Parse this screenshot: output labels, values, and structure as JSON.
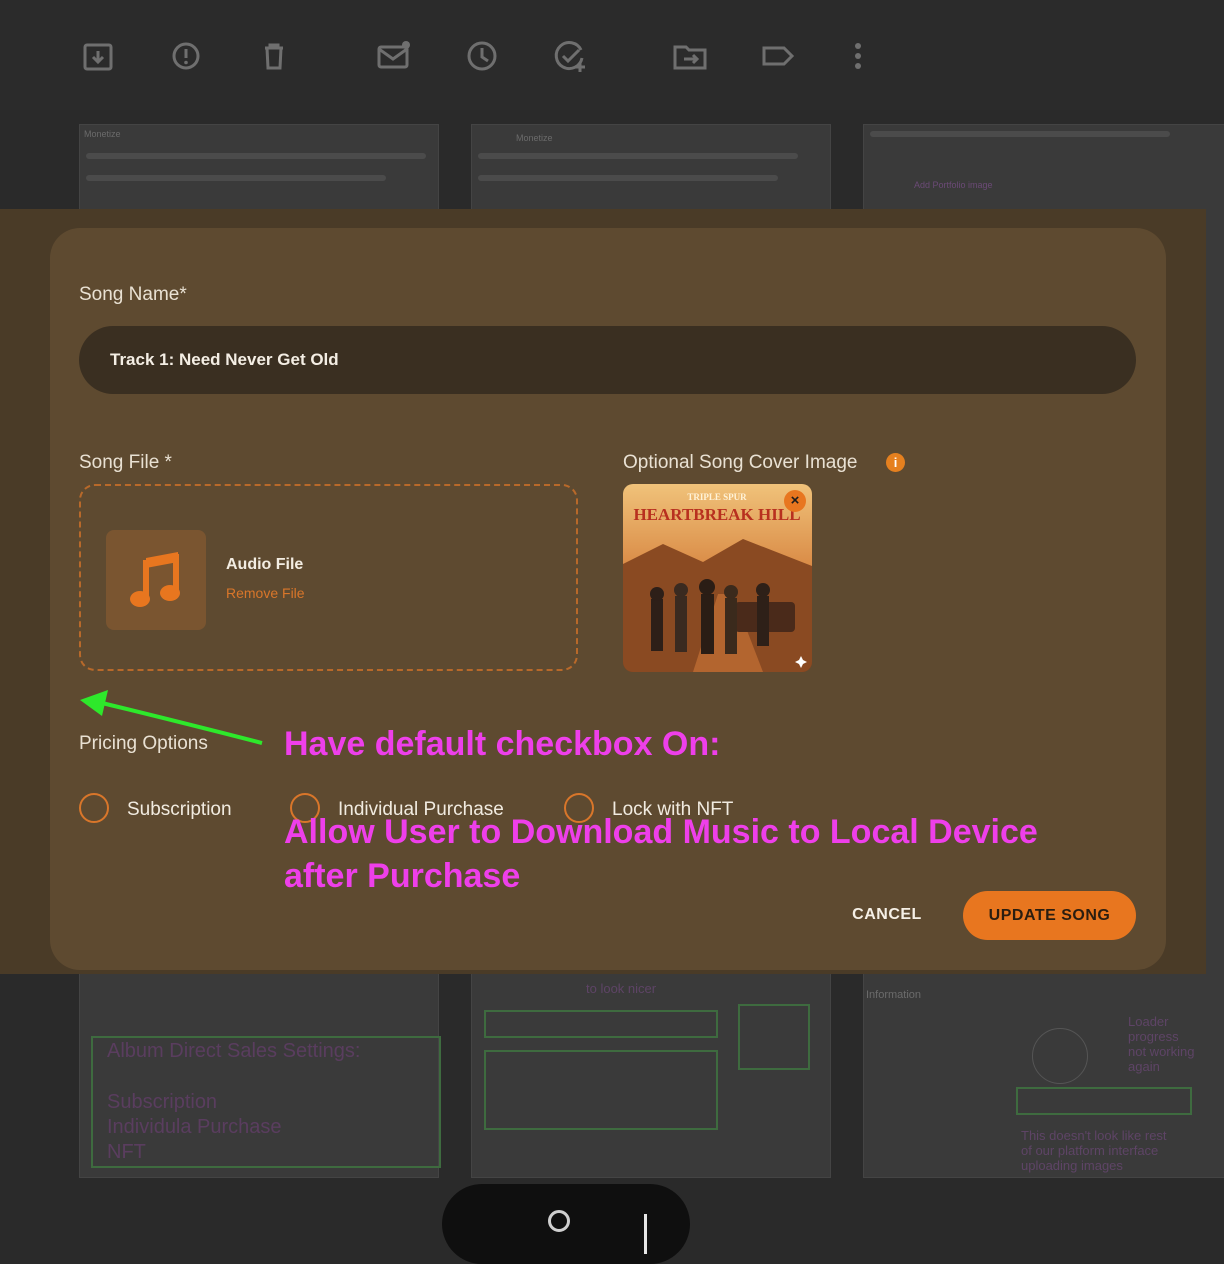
{
  "toolbar": {
    "icons": [
      "archive-icon",
      "report-icon",
      "delete-icon",
      "mark-unread-icon",
      "snooze-icon",
      "add-task-icon",
      "move-to-icon",
      "label-icon",
      "more-icon"
    ]
  },
  "modal": {
    "song_name_label": "Song Name*",
    "song_name_value": "Track 1: Need Never Get Old",
    "song_file_label": "Song File *",
    "cover_label": "Optional Song Cover Image",
    "info_glyph": "i",
    "file": {
      "title": "Audio File",
      "remove": "Remove File"
    },
    "cover_art": {
      "band": "TRIPLE SPUR",
      "title": "HEARTBREAK HILL"
    },
    "cover_close": "×",
    "pricing_label": "Pricing Options",
    "pricing_options": [
      "Subscription",
      "Individual Purchase",
      "Lock with NFT"
    ],
    "cancel_label": "CANCEL",
    "update_label": "UPDATE SONG"
  },
  "annotations": {
    "line1": "Have default checkbox On:",
    "line2": "Allow User to Download Music to Local Device",
    "line3": "after Purchase"
  },
  "background": {
    "thumb_title": "Monetize",
    "notes": {
      "album_settings": [
        "Album Direct Sales Settings:",
        "",
        "Subscription",
        "Individula Purchase",
        "NFT"
      ],
      "look_nicer": "to look nicer",
      "loader": [
        "Loader",
        "progress",
        "not working",
        "again"
      ],
      "interface": [
        "This doesn't look like rest",
        "of our platform interface",
        "uploading images"
      ],
      "information": "Information",
      "add_portfolio_image": "Add Portfolio image"
    }
  },
  "colors": {
    "accent": "#e8761f",
    "modal_bg": "#5e4a30",
    "annotation": "#ee3fea",
    "arrow": "#2ee82b"
  }
}
